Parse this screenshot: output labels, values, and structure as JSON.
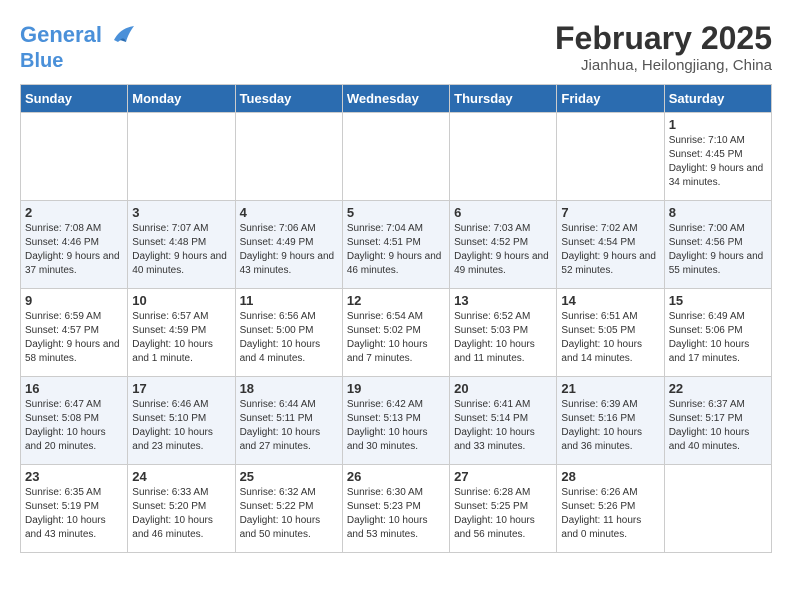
{
  "header": {
    "logo_line1": "General",
    "logo_line2": "Blue",
    "month": "February 2025",
    "location": "Jianhua, Heilongjiang, China"
  },
  "days": [
    "Sunday",
    "Monday",
    "Tuesday",
    "Wednesday",
    "Thursday",
    "Friday",
    "Saturday"
  ],
  "weeks": [
    [
      {
        "date": "",
        "info": ""
      },
      {
        "date": "",
        "info": ""
      },
      {
        "date": "",
        "info": ""
      },
      {
        "date": "",
        "info": ""
      },
      {
        "date": "",
        "info": ""
      },
      {
        "date": "",
        "info": ""
      },
      {
        "date": "1",
        "info": "Sunrise: 7:10 AM\nSunset: 4:45 PM\nDaylight: 9 hours and 34 minutes."
      }
    ],
    [
      {
        "date": "2",
        "info": "Sunrise: 7:08 AM\nSunset: 4:46 PM\nDaylight: 9 hours and 37 minutes."
      },
      {
        "date": "3",
        "info": "Sunrise: 7:07 AM\nSunset: 4:48 PM\nDaylight: 9 hours and 40 minutes."
      },
      {
        "date": "4",
        "info": "Sunrise: 7:06 AM\nSunset: 4:49 PM\nDaylight: 9 hours and 43 minutes."
      },
      {
        "date": "5",
        "info": "Sunrise: 7:04 AM\nSunset: 4:51 PM\nDaylight: 9 hours and 46 minutes."
      },
      {
        "date": "6",
        "info": "Sunrise: 7:03 AM\nSunset: 4:52 PM\nDaylight: 9 hours and 49 minutes."
      },
      {
        "date": "7",
        "info": "Sunrise: 7:02 AM\nSunset: 4:54 PM\nDaylight: 9 hours and 52 minutes."
      },
      {
        "date": "8",
        "info": "Sunrise: 7:00 AM\nSunset: 4:56 PM\nDaylight: 9 hours and 55 minutes."
      }
    ],
    [
      {
        "date": "9",
        "info": "Sunrise: 6:59 AM\nSunset: 4:57 PM\nDaylight: 9 hours and 58 minutes."
      },
      {
        "date": "10",
        "info": "Sunrise: 6:57 AM\nSunset: 4:59 PM\nDaylight: 10 hours and 1 minute."
      },
      {
        "date": "11",
        "info": "Sunrise: 6:56 AM\nSunset: 5:00 PM\nDaylight: 10 hours and 4 minutes."
      },
      {
        "date": "12",
        "info": "Sunrise: 6:54 AM\nSunset: 5:02 PM\nDaylight: 10 hours and 7 minutes."
      },
      {
        "date": "13",
        "info": "Sunrise: 6:52 AM\nSunset: 5:03 PM\nDaylight: 10 hours and 11 minutes."
      },
      {
        "date": "14",
        "info": "Sunrise: 6:51 AM\nSunset: 5:05 PM\nDaylight: 10 hours and 14 minutes."
      },
      {
        "date": "15",
        "info": "Sunrise: 6:49 AM\nSunset: 5:06 PM\nDaylight: 10 hours and 17 minutes."
      }
    ],
    [
      {
        "date": "16",
        "info": "Sunrise: 6:47 AM\nSunset: 5:08 PM\nDaylight: 10 hours and 20 minutes."
      },
      {
        "date": "17",
        "info": "Sunrise: 6:46 AM\nSunset: 5:10 PM\nDaylight: 10 hours and 23 minutes."
      },
      {
        "date": "18",
        "info": "Sunrise: 6:44 AM\nSunset: 5:11 PM\nDaylight: 10 hours and 27 minutes."
      },
      {
        "date": "19",
        "info": "Sunrise: 6:42 AM\nSunset: 5:13 PM\nDaylight: 10 hours and 30 minutes."
      },
      {
        "date": "20",
        "info": "Sunrise: 6:41 AM\nSunset: 5:14 PM\nDaylight: 10 hours and 33 minutes."
      },
      {
        "date": "21",
        "info": "Sunrise: 6:39 AM\nSunset: 5:16 PM\nDaylight: 10 hours and 36 minutes."
      },
      {
        "date": "22",
        "info": "Sunrise: 6:37 AM\nSunset: 5:17 PM\nDaylight: 10 hours and 40 minutes."
      }
    ],
    [
      {
        "date": "23",
        "info": "Sunrise: 6:35 AM\nSunset: 5:19 PM\nDaylight: 10 hours and 43 minutes."
      },
      {
        "date": "24",
        "info": "Sunrise: 6:33 AM\nSunset: 5:20 PM\nDaylight: 10 hours and 46 minutes."
      },
      {
        "date": "25",
        "info": "Sunrise: 6:32 AM\nSunset: 5:22 PM\nDaylight: 10 hours and 50 minutes."
      },
      {
        "date": "26",
        "info": "Sunrise: 6:30 AM\nSunset: 5:23 PM\nDaylight: 10 hours and 53 minutes."
      },
      {
        "date": "27",
        "info": "Sunrise: 6:28 AM\nSunset: 5:25 PM\nDaylight: 10 hours and 56 minutes."
      },
      {
        "date": "28",
        "info": "Sunrise: 6:26 AM\nSunset: 5:26 PM\nDaylight: 11 hours and 0 minutes."
      },
      {
        "date": "",
        "info": ""
      }
    ]
  ]
}
